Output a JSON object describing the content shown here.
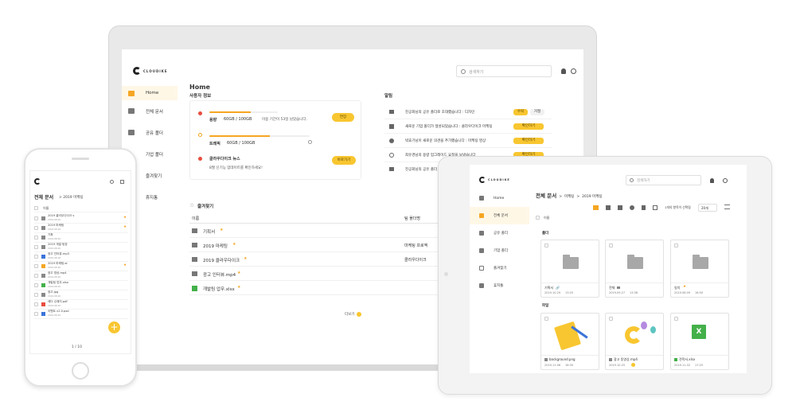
{
  "laptop": {
    "logo": "CLOUDIKE",
    "search": {
      "placeholder": "검색하기"
    },
    "sidebar": {
      "items": [
        {
          "label": "Home",
          "icon": "home-icon"
        },
        {
          "label": "전체 문서",
          "icon": "folder-icon"
        },
        {
          "label": "공유 폴더",
          "icon": "people-icon"
        },
        {
          "label": "기업 폴더",
          "icon": "building-icon"
        },
        {
          "label": "즐겨찾기",
          "icon": "star-icon"
        },
        {
          "label": "휴지통",
          "icon": "trash-icon"
        }
      ]
    },
    "home_title": "Home",
    "user_info": {
      "title": "사용자 정보",
      "storage": {
        "label": "용량",
        "value": "60GB / 100GB",
        "note": "이용 기간이 53일 남았습니다.",
        "button": "연장",
        "fill": 0.6
      },
      "traffic": {
        "label": "트래픽",
        "value": "60GB / 100GB",
        "fill": 0.6
      },
      "news": {
        "title": "클라우다이크 뉴스",
        "text": "8월 신기능 업데이트를 확인하세요!",
        "button": "바로가기"
      }
    },
    "notifications": {
      "title": "알림",
      "items": [
        {
          "text": "진공회님의 공유 폴더로 초대했습니다 : 디자인",
          "actions": [
            "수락",
            "거절"
          ]
        },
        {
          "text": "새로운 기업 폴더가 생성되었습니다 : 클라우다이크 마케팅",
          "actions": [
            "확인하기"
          ]
        },
        {
          "text": "박효기님이 새로운 의견을 추가했습니다 : 마케팅 영상",
          "actions": [
            "확인하기"
          ]
        },
        {
          "text": "최유경님의 용량 업그레이드 요청을 보냈습니다",
          "actions": [
            "확인하기"
          ]
        },
        {
          "text": "진공회님의 공유 폴더",
          "actions": []
        }
      ]
    },
    "favorites": {
      "title": "즐겨찾기",
      "col_name": "이름",
      "col_team": "팀 폴더명",
      "rows": [
        {
          "name": "기획서",
          "team": "",
          "icon": "folder-icon"
        },
        {
          "name": "2019 마케팅",
          "team": "마케팅 프로젝",
          "icon": "folder-icon"
        },
        {
          "name": "2019 클라우다이크",
          "team": "클라우다이크",
          "icon": "video-icon"
        },
        {
          "name": "광고 인터뷰.mp4",
          "team": "",
          "icon": "image-icon"
        },
        {
          "name": "개발팀 업무.xlsx",
          "team": "",
          "icon": "excel-icon"
        }
      ],
      "more": "더보기"
    }
  },
  "phone": {
    "title": "전체 문서",
    "breadcrumb": "2019 마케팅",
    "col_name": "이름",
    "rows": [
      {
        "name": "2019 클라우다이크 v",
        "date": "2019.08.26"
      },
      {
        "name": "2019 마케팅",
        "date": "2019.08.26"
      },
      {
        "name": "기획",
        "date": "2019.08.26"
      },
      {
        "name": "2019 개발 팀장",
        "date": "2019.08.26"
      },
      {
        "name": "광고 인터뷰.mp3",
        "date": "2019.08.26"
      },
      {
        "name": "2019 마케팅.ai",
        "date": "2019.08.26"
      },
      {
        "name": "광고 영상.mp4",
        "date": "2019.08.26"
      },
      {
        "name": "개발팀 업무.xlsx",
        "date": "2019.08.26"
      },
      {
        "name": "광고.jpg",
        "date": "2019.08.26"
      },
      {
        "name": "레더 수채지.pdf",
        "date": "2019.08.26"
      },
      {
        "name": "이벤트 v2.0.psd",
        "date": "2019.08.26"
      }
    ],
    "pager": "1 / 10"
  },
  "tablet": {
    "logo": "CLOUDIKE",
    "search": {
      "placeholder": "검색하기"
    },
    "sidebar": {
      "items": [
        {
          "label": "Home"
        },
        {
          "label": "전체 문서"
        },
        {
          "label": "공유 폴더"
        },
        {
          "label": "기업 폴더"
        },
        {
          "label": "즐겨찾기"
        },
        {
          "label": "휴지통"
        }
      ]
    },
    "breadcrumb": {
      "root": "전체 문서",
      "mid": "마케팅",
      "current": "2019 마케팅"
    },
    "toolbar": {
      "selected_text": "1개의 항목이 선택됨",
      "page_size": "20개"
    },
    "sort_label": "이름",
    "folders_label": "폴더",
    "files_label": "파일",
    "folders": [
      {
        "name": "기획서",
        "date": "2019.10.29",
        "time": "13:25"
      },
      {
        "name": "전체",
        "date": "2019.09.27",
        "time": "13:36"
      },
      {
        "name": "일치",
        "date": "2019.08.09",
        "time": "16:50"
      }
    ],
    "files": [
      {
        "name": "background.png",
        "date": "2019.11.06",
        "time": "16:30"
      },
      {
        "name": "광고 동영상.mp4",
        "date": "2019.10.25",
        "time": "14:30"
      },
      {
        "name": "견적서.xlsx",
        "date": "2019.11.02",
        "time": "17:25"
      }
    ],
    "colors": {
      "accent": "#f8c630",
      "excel": "#43b049"
    }
  }
}
